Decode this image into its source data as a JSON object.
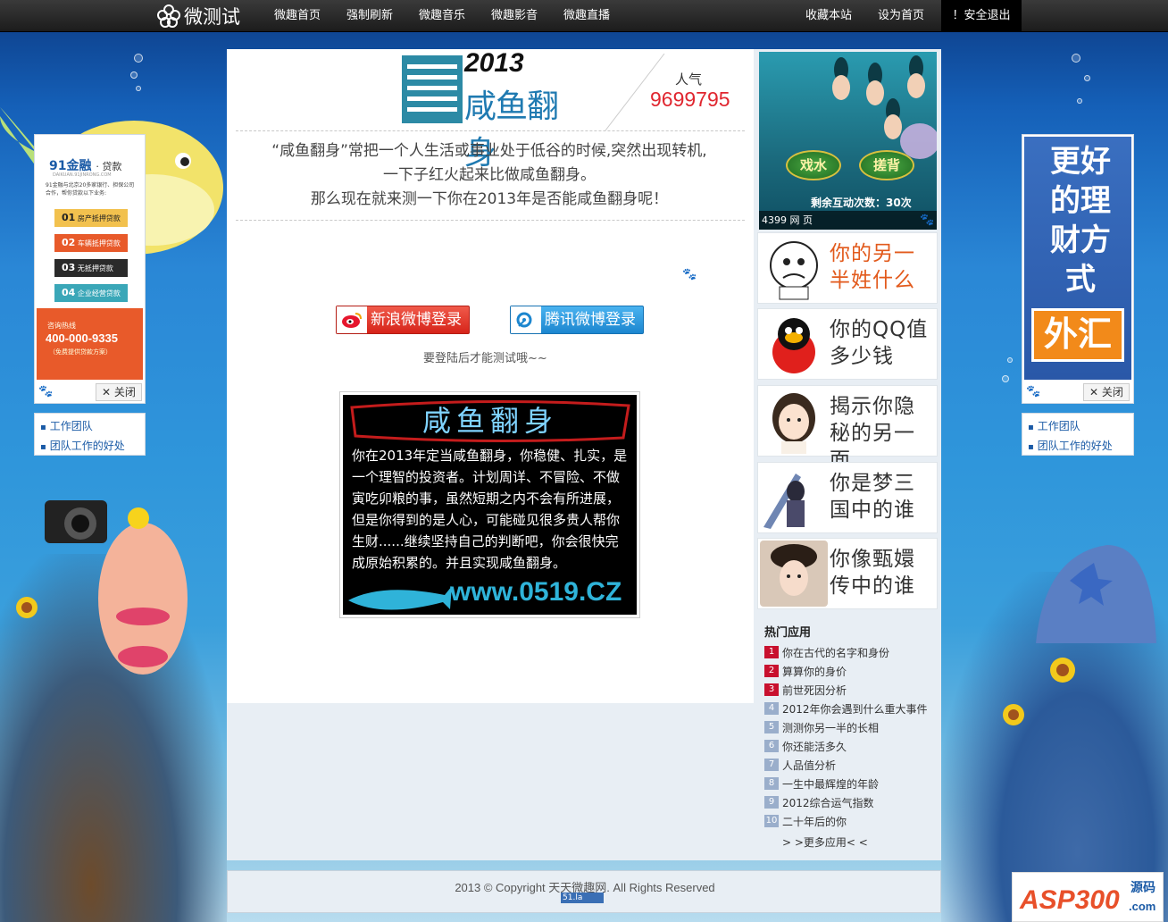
{
  "nav": {
    "logo": "微测试",
    "links": [
      "微趣首页",
      "强制刷新",
      "微趣音乐",
      "微趣影音",
      "微趣直播"
    ],
    "right_links": [
      "收藏本站",
      "设为首页"
    ],
    "logout": "！安全退出"
  },
  "banner": {
    "year": "2013",
    "title": "咸鱼翻身",
    "popularity_label": "人气",
    "popularity_value": "9699795"
  },
  "description": {
    "line1": "“咸鱼翻身”常把一个人生活或事业处于低谷的时候,突然出现转机,",
    "line2": "一下子红火起来比做咸鱼翻身。",
    "line3": "那么现在就来测一下你在2013年是否能咸鱼翻身呢！"
  },
  "login": {
    "sina": "新浪微博登录",
    "qq": "腾讯微博登录",
    "note": "要登陆后才能测试哦~~"
  },
  "result": {
    "title": "咸鱼翻身",
    "text": "你在2013年定当咸鱼翻身，你稳健、扎实，是一个理智的投资者。计划周详、不冒险、不做寅吃卯粮的事，虽然短期之内不会有所进展，但是你得到的是人心，可能碰见很多贵人帮你生财......继续坚持自己的判断吧，你会很快完成原始积累的。并且实现咸鱼翻身。",
    "watermark": "www.0519.CZ"
  },
  "left_ad": {
    "brand": "91金融",
    "brand_suffix": "· 贷款",
    "site": "DAIKUAN.91JINRONG.COM",
    "intro": "91金融与北京20多家银行、担保公司合作，帮你贷款以下业务:",
    "items": [
      {
        "num": "01",
        "label": "房产抵押贷款",
        "color": "#f2c14e"
      },
      {
        "num": "02",
        "label": "车辆抵押贷款",
        "color": "#e85a2a"
      },
      {
        "num": "03",
        "label": "无抵押贷款",
        "color": "#2a2a2a"
      },
      {
        "num": "04",
        "label": "企业经营贷款",
        "color": "#3aa7b8"
      }
    ],
    "hotline_label": "咨询热线",
    "hotline": "400-000-9335",
    "hotline_note": "（免费提供贷款方案）",
    "close": "✕ 关闭"
  },
  "right_ad": {
    "headline": "更好的理财方式",
    "highlight": "外汇",
    "close": "✕ 关闭"
  },
  "side_links": [
    "工作团队",
    "团队工作的好处"
  ],
  "game_ad": {
    "btn1": "戏水",
    "btn2": "搓背",
    "remaining": "剩余互动次数：30次",
    "footer": "4399 网 页"
  },
  "quizzes": [
    {
      "text": "你的另一半姓什么",
      "color": "#e25a1c"
    },
    {
      "text": "你的QQ值多少钱",
      "color": "#333333"
    },
    {
      "text": "揭示你隐秘的另一面",
      "color": "#333333"
    },
    {
      "text": "你是梦三国中的谁",
      "color": "#333333"
    },
    {
      "text": "你像甄嬛传中的谁",
      "color": "#333333"
    }
  ],
  "hot_apps": {
    "title": "热门应用",
    "items": [
      "你在古代的名字和身份",
      "算算你的身价",
      "前世死因分析",
      "2012年你会遇到什么重大事件",
      "测测你另一半的长相",
      "你还能活多久",
      "人品值分析",
      "一生中最辉煌的年龄",
      "2012综合运气指数",
      "二十年后的你"
    ],
    "more": "> >更多应用< <"
  },
  "footer": {
    "copyright": "2013 © Copyright 天天微趣网. All Rights Reserved",
    "stat": "51.la"
  },
  "corner_logo": {
    "text": "ASP300",
    "sub": "源码",
    "domain": ".com"
  }
}
